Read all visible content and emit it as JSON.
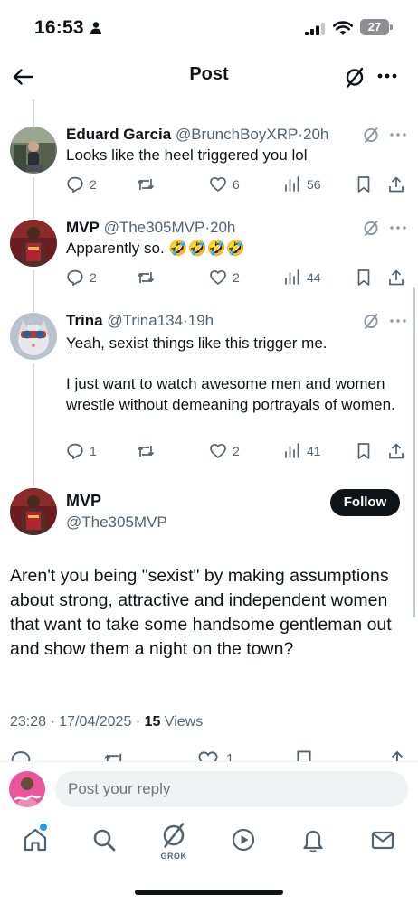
{
  "status": {
    "time": "16:53",
    "battery": "27"
  },
  "header": {
    "title": "Post"
  },
  "replies": [
    {
      "name": "Eduard Garcia",
      "handle": "@BrunchBoyXRP",
      "sep": "·",
      "age": "20h",
      "text": [
        "Looks like the heel triggered you lol"
      ],
      "stats": {
        "replies": "2",
        "reposts": "",
        "likes": "6",
        "views": "56"
      }
    },
    {
      "name": "MVP",
      "handle": "@The305MVP",
      "sep": "·",
      "age": "20h",
      "text": [
        "Apparently so. 🤣🤣🤣🤣"
      ],
      "stats": {
        "replies": "2",
        "reposts": "",
        "likes": "2",
        "views": "44"
      }
    },
    {
      "name": "Trina",
      "handle": "@Trina134",
      "sep": "·",
      "age": "19h",
      "text": [
        "Yeah, sexist things like this trigger me.",
        "I  just want to watch awesome men and women wrestle without demeaning portrayals of women."
      ],
      "stats": {
        "replies": "1",
        "reposts": "",
        "likes": "2",
        "views": "41"
      }
    }
  ],
  "main_post": {
    "name": "MVP",
    "handle": "@The305MVP",
    "follow_label": "Follow",
    "text": "Aren't you being \"sexist\" by making assumptions about strong, attractive and independent women that want to take some handsome gentleman out and show them a night on the town?",
    "timestamp": "23:28 · 17/04/2025 · ",
    "views_count": "15",
    "views_label": " Views",
    "likes_partial": "1"
  },
  "composer": {
    "placeholder": "Post your reply"
  },
  "tabbar": {
    "grok_label": "GROK"
  },
  "colors": {
    "accent": "#1d9bf0",
    "text": "#0f1419",
    "muted": "#536471",
    "line": "#cfd9de"
  },
  "icons": [
    "back-arrow-icon",
    "grok-icon",
    "more-icon",
    "reply-icon",
    "repost-icon",
    "like-icon",
    "views-icon",
    "bookmark-icon",
    "share-icon",
    "home-icon",
    "search-icon",
    "play-icon",
    "bell-icon",
    "mail-icon"
  ]
}
